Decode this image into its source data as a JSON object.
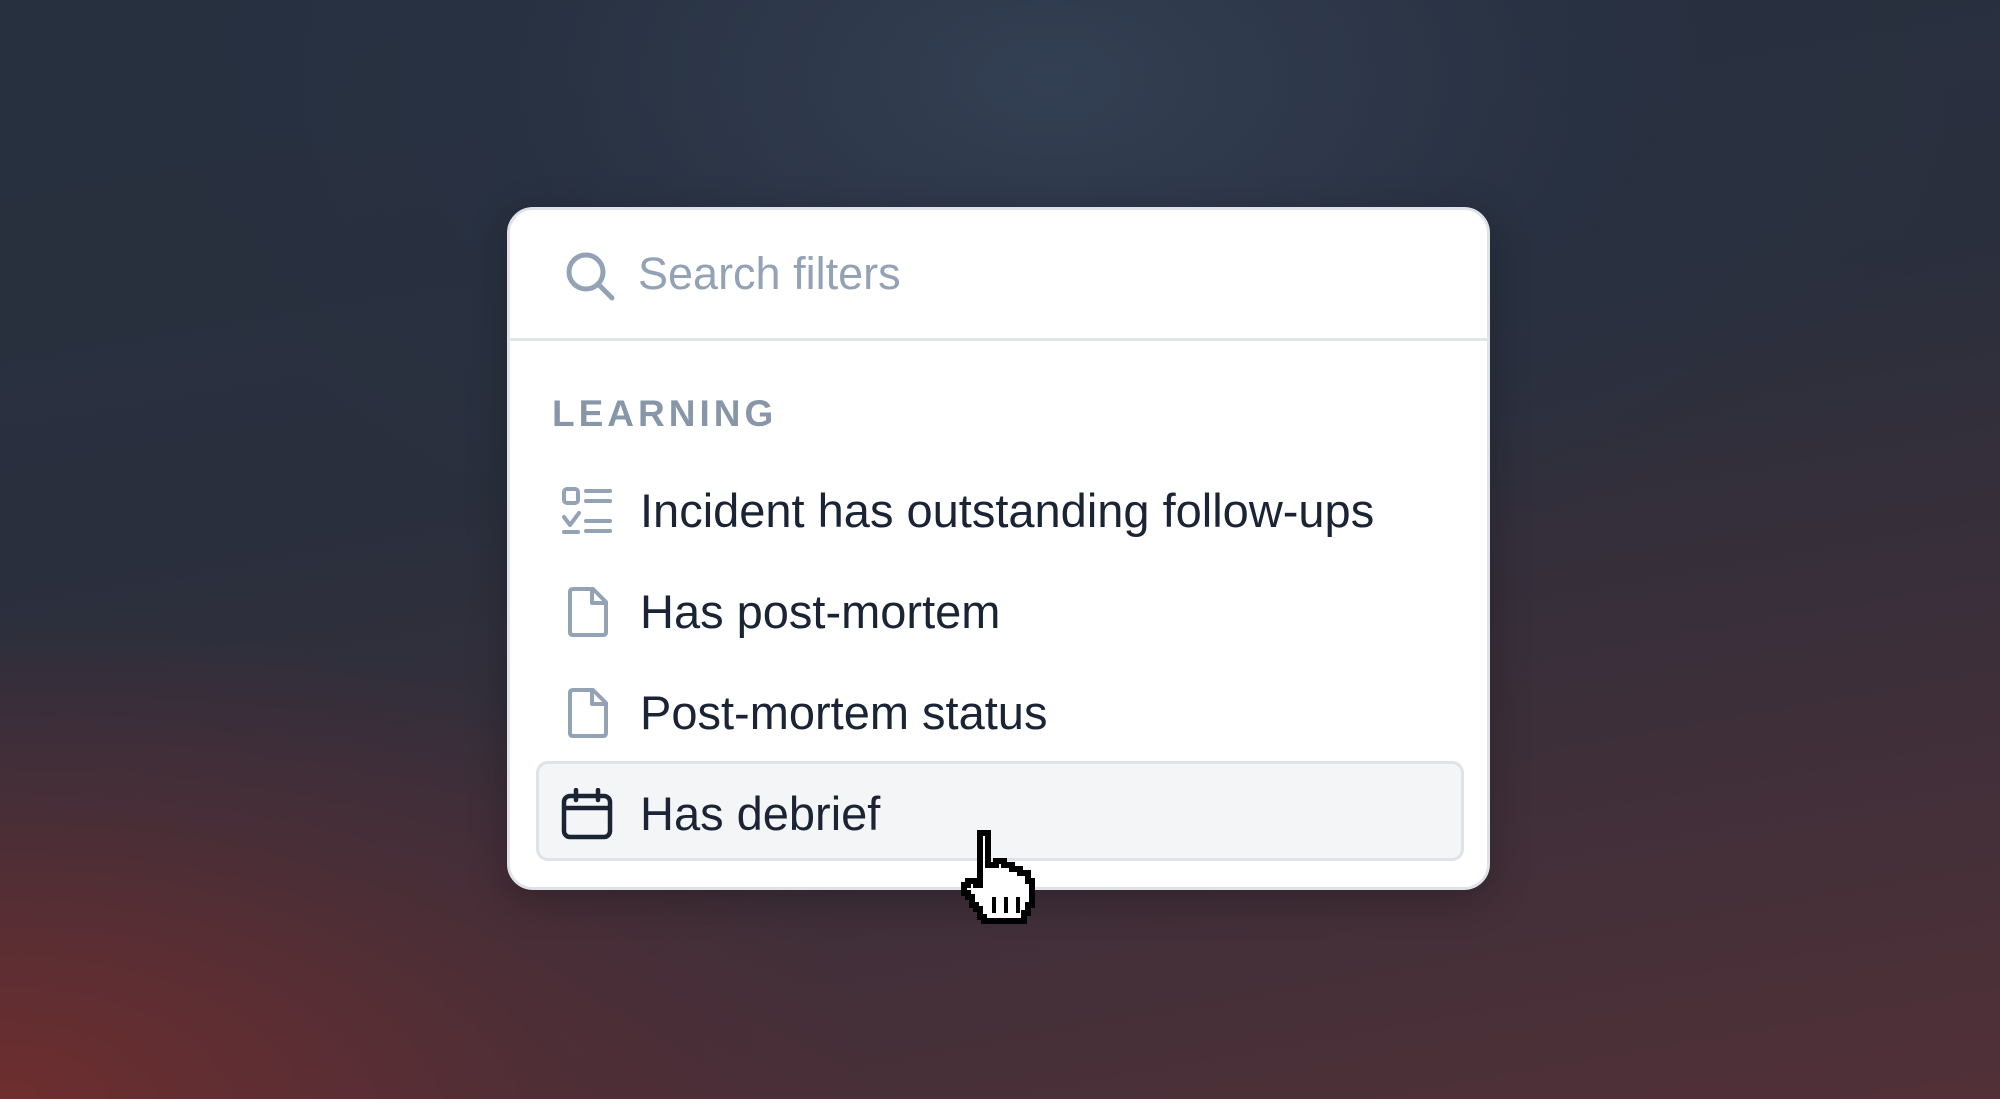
{
  "search": {
    "placeholder": "Search filters",
    "icon": "search-icon"
  },
  "section": {
    "label": "LEARNING"
  },
  "items": [
    {
      "label": "Incident has outstanding follow-ups",
      "icon": "checklist-icon",
      "hovered": false
    },
    {
      "label": "Has post-mortem",
      "icon": "document-icon",
      "hovered": false
    },
    {
      "label": "Post-mortem status",
      "icon": "document-icon",
      "hovered": false
    },
    {
      "label": "Has debrief",
      "icon": "calendar-icon",
      "hovered": true
    }
  ],
  "colors": {
    "icon_muted": "#93a3b5",
    "icon_active": "#1a2434",
    "text": "#1a2434",
    "hover_bg": "#f3f5f7"
  }
}
